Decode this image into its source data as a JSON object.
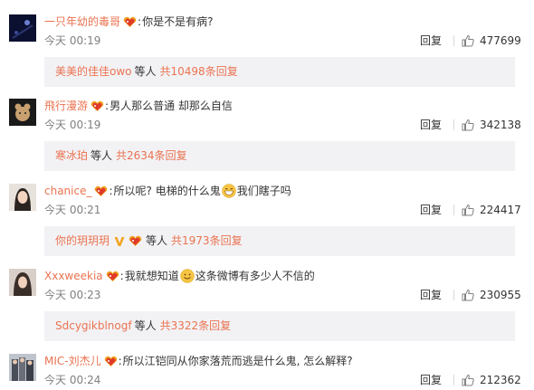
{
  "comments": [
    {
      "username": "一只年幼的毒哥",
      "text": "你是不是有病?",
      "time": "今天 00:19",
      "reply_label": "回复",
      "likes": "477699",
      "sub": {
        "user": "美美的佳佳owo",
        "deng": "等人",
        "total": "共10498条回复"
      }
    },
    {
      "username": "飛行漫游",
      "text": "男人那么普通 却那么自信",
      "time": "今天 00:19",
      "reply_label": "回复",
      "likes": "342138",
      "sub": {
        "user": "寒冰珀",
        "deng": "等人",
        "total": "共2634条回复"
      }
    },
    {
      "username": "chanice_",
      "text_a": "所以呢? 电梯的什么鬼",
      "emoji": "grin-emoji",
      "text_b": "我们瞎子吗",
      "time": "今天 00:21",
      "reply_label": "回复",
      "likes": "224417",
      "sub": {
        "user": "你的玥玥玥",
        "deng": "等人",
        "total": "共1973条回复"
      }
    },
    {
      "username": "Xxxweekia",
      "text_a": "我就想知道",
      "emoji": "smile-emoji",
      "text_b": "这条微博有多少人不信的",
      "time": "今天 00:23",
      "reply_label": "回复",
      "likes": "230955",
      "sub": {
        "user": "Sdcygikblnogf",
        "deng": "等人",
        "total": "共3322条回复"
      }
    },
    {
      "username": "MIC-刘杰儿",
      "text": "所以江铠同从你家落荒而逃是什么鬼, 怎么解释?",
      "time": "今天 00:24",
      "reply_label": "回复",
      "likes": "212362"
    }
  ],
  "colors": {
    "username": "#eb7350",
    "subbox_bg": "#f2f2f5",
    "time": "#808080"
  }
}
